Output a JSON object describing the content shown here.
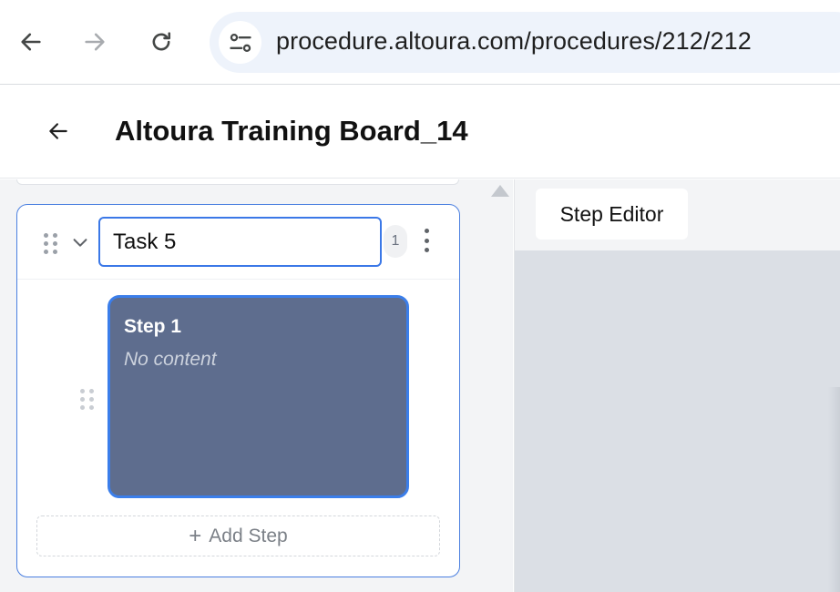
{
  "browser": {
    "url": "procedure.altoura.com/procedures/212/212",
    "icons": {
      "back": "arrow-left-icon",
      "forward": "arrow-right-icon",
      "reload": "reload-icon",
      "site_info": "tune-icon"
    }
  },
  "header": {
    "title": "Altoura Training Board_14",
    "back_icon": "arrow-left-icon"
  },
  "task": {
    "name": "Task 5",
    "step_count": "1",
    "steps": [
      {
        "title": "Step 1",
        "subtitle": "No content"
      }
    ],
    "add_step_label": "Add Step"
  },
  "editor": {
    "tab_label": "Step Editor"
  },
  "colors": {
    "accent": "#3b78e7",
    "step_card": "#5e6d8e",
    "panel_bg": "#f3f4f6",
    "canvas_bg": "#dbdfe5"
  }
}
